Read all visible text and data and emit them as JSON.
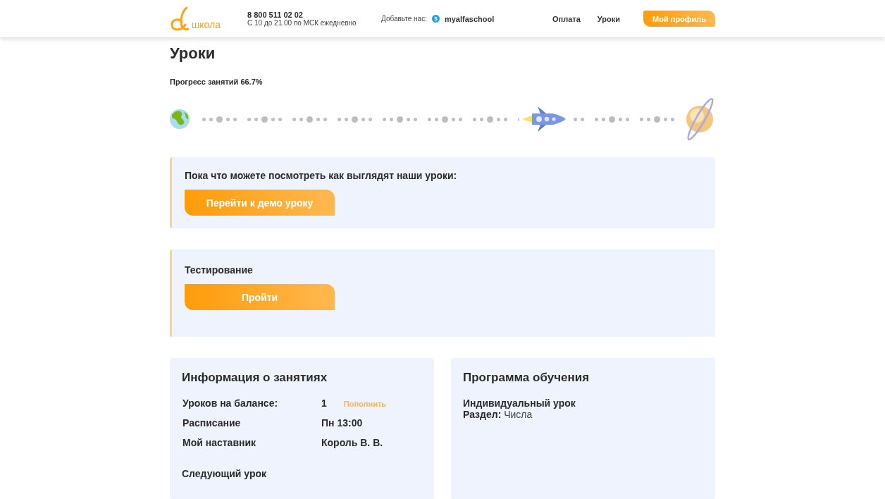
{
  "header": {
    "logo_text": "школа",
    "phone": "8 800 511 02 02",
    "hours": "С 10 до 21.00 по МСК ежедневно",
    "add_us_label": "Добавьте нас:",
    "skype": "myalfaschool",
    "nav": [
      {
        "label": "Оплата"
      },
      {
        "label": "Уроки"
      }
    ],
    "profile_button": "Мой профиль"
  },
  "page_title": "Уроки",
  "progress": {
    "label": "Прогресс занятий 66.7%",
    "level": 0.667
  },
  "demo_card": {
    "title": "Пока что можете посмотреть как выглядят наши уроки:",
    "button": "Перейти к демо уроку"
  },
  "test_card": {
    "title": "Тестирование",
    "button": "Пройти"
  },
  "info_card": {
    "title": "Информация о занятиях",
    "rows": [
      {
        "label": "Уроков на балансе:",
        "value": "1",
        "link": "Пополнить"
      },
      {
        "label": "Расписание",
        "value": "Пн 13:00"
      },
      {
        "label": "Мой наставник",
        "value": "Король В. В."
      }
    ],
    "next_lesson": "Следующий урок"
  },
  "program_card": {
    "title": "Программа обучения",
    "lesson_type": "Индивидуальный урок",
    "section_label": "Раздел:",
    "section_value": "Числа"
  }
}
